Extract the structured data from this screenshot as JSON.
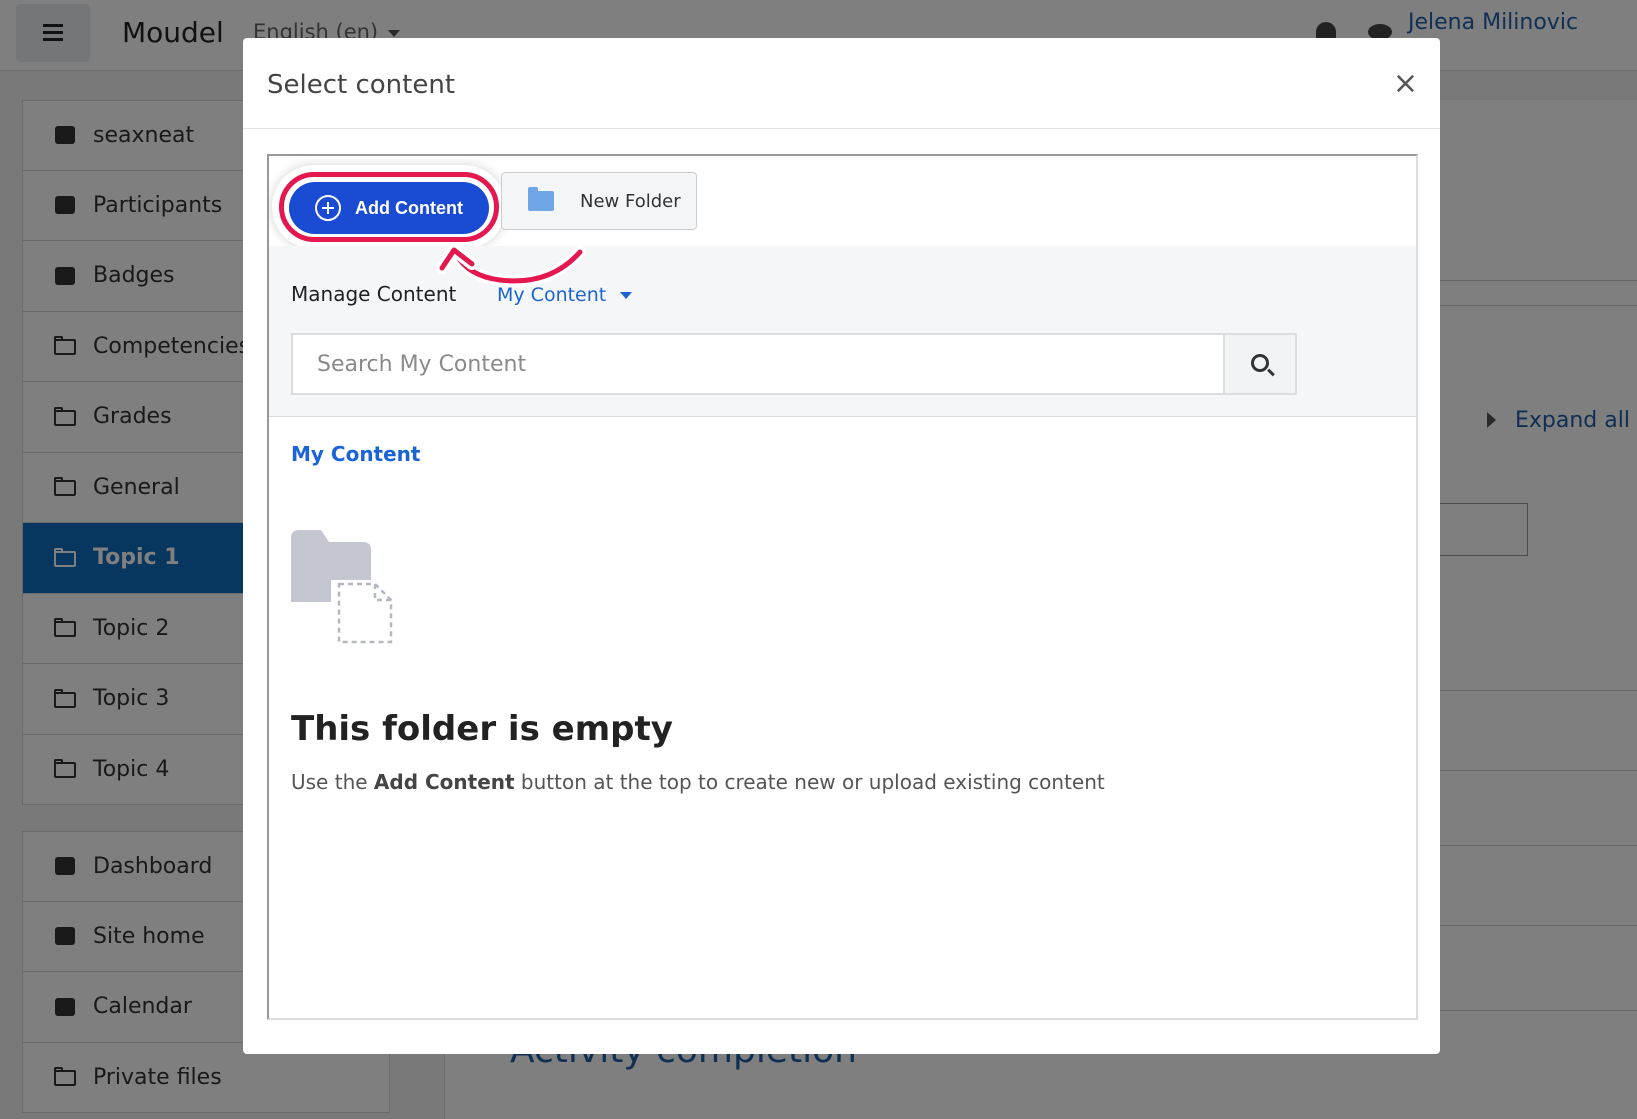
{
  "app": {
    "brand": "Moudel",
    "language": "English (en)",
    "username": "Jelena Milinovic"
  },
  "sidebar": {
    "items": [
      {
        "label": "seaxneat",
        "icon": "graduation-cap-icon"
      },
      {
        "label": "Participants",
        "icon": "users-icon"
      },
      {
        "label": "Badges",
        "icon": "shield-icon"
      },
      {
        "label": "Competencies",
        "icon": "check-square-icon"
      },
      {
        "label": "Grades",
        "icon": "table-icon"
      },
      {
        "label": "General",
        "icon": "folder-icon"
      },
      {
        "label": "Topic 1",
        "icon": "folder-icon",
        "active": true
      },
      {
        "label": "Topic 2",
        "icon": "folder-icon"
      },
      {
        "label": "Topic 3",
        "icon": "folder-icon"
      },
      {
        "label": "Topic 4",
        "icon": "folder-icon"
      }
    ],
    "secondary": [
      {
        "label": "Dashboard",
        "icon": "dashboard-icon"
      },
      {
        "label": "Site home",
        "icon": "home-icon"
      },
      {
        "label": "Calendar",
        "icon": "calendar-icon"
      },
      {
        "label": "Private files",
        "icon": "file-icon"
      }
    ]
  },
  "background": {
    "expand_all": "Expand all",
    "section_heading": "Activity completion"
  },
  "modal": {
    "title": "Select content",
    "close": "×",
    "toolbar": {
      "add_content": "Add Content",
      "new_folder": "New Folder"
    },
    "manage": {
      "label": "Manage Content",
      "selector": "My Content",
      "search_placeholder": "Search My Content"
    },
    "breadcrumb": "My Content",
    "empty": {
      "title": "This folder is empty",
      "desc_prefix": "Use the ",
      "desc_bold": "Add Content",
      "desc_suffix": " button at the top to create new or upload existing content"
    }
  },
  "colors": {
    "accent": "#1a4bd3",
    "highlight": "#e5174f",
    "link": "#1a64d6",
    "sidebar_active": "#0f6cbf"
  }
}
